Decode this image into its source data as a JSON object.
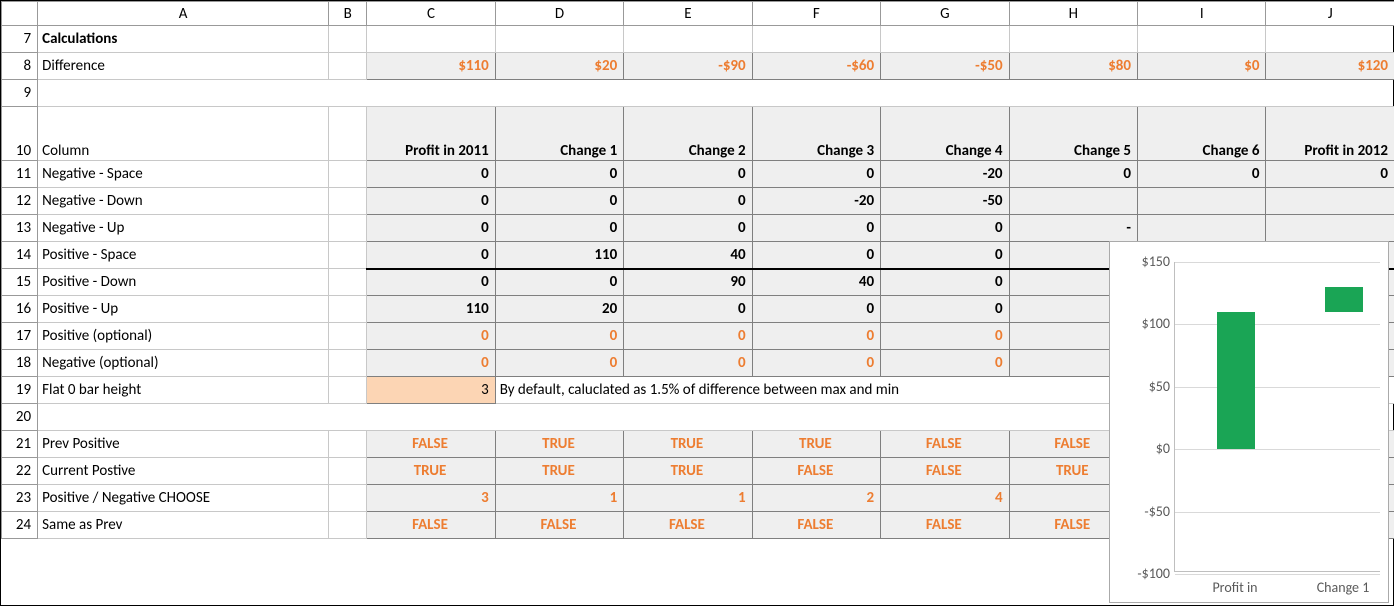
{
  "columns": [
    "A",
    "B",
    "C",
    "D",
    "E",
    "F",
    "G",
    "H",
    "I",
    "J"
  ],
  "rowNums": [
    7,
    8,
    9,
    10,
    11,
    12,
    13,
    14,
    15,
    16,
    17,
    18,
    19,
    20,
    21,
    22,
    23,
    24
  ],
  "labels": {
    "r7": "Calculations",
    "r8": "Difference",
    "r10": "Column",
    "r11": "Negative - Space",
    "r12": "Negative - Down",
    "r13": "Negative - Up",
    "r14": "Positive - Space",
    "r15": "Positive - Down",
    "r16": "Positive - Up",
    "r17": "Positive (optional)",
    "r18": "Negative (optional)",
    "r19": "Flat 0 bar height",
    "r21": "Prev Positive",
    "r22": "Current Postive",
    "r23": "Positive / Negative CHOOSE",
    "r24": "Same as Prev"
  },
  "diff": [
    "$110",
    "$20",
    "-$90",
    "-$60",
    "-$50",
    "$80",
    "$0",
    "$120"
  ],
  "colHdrs": [
    "Profit in 2011",
    "Change 1",
    "Change 2",
    "Change 3",
    "Change 4",
    "Change 5",
    "Change 6",
    "Profit in 2012"
  ],
  "r11": [
    "0",
    "0",
    "0",
    "0",
    "-20",
    "0",
    "0",
    "0"
  ],
  "r12": [
    "0",
    "0",
    "0",
    "-20",
    "-50",
    "",
    "",
    ""
  ],
  "r13": [
    "0",
    "0",
    "0",
    "0",
    "0",
    "-",
    "",
    ""
  ],
  "r14": [
    "0",
    "110",
    "40",
    "0",
    "0",
    "",
    "",
    ""
  ],
  "r15": [
    "0",
    "0",
    "90",
    "40",
    "0",
    "",
    "",
    ""
  ],
  "r16": [
    "110",
    "20",
    "0",
    "0",
    "0",
    "",
    "",
    ""
  ],
  "r17": [
    "0",
    "0",
    "0",
    "0",
    "0",
    "",
    "",
    ""
  ],
  "r18": [
    "0",
    "0",
    "0",
    "0",
    "0",
    "",
    "",
    ""
  ],
  "r19_val": "3",
  "r19_note": "By default, caluclated as 1.5% of difference between max and min",
  "r21": [
    "FALSE",
    "TRUE",
    "TRUE",
    "TRUE",
    "FALSE",
    "FALSE",
    "",
    ""
  ],
  "r22": [
    "TRUE",
    "TRUE",
    "TRUE",
    "FALSE",
    "FALSE",
    "TRUE",
    "",
    ""
  ],
  "r23": [
    "3",
    "1",
    "1",
    "2",
    "4",
    "",
    "",
    ""
  ],
  "r24": [
    "FALSE",
    "FALSE",
    "FALSE",
    "FALSE",
    "FALSE",
    "FALSE",
    "",
    ""
  ],
  "chart_data": {
    "type": "bar",
    "categories": [
      "Profit in",
      "Change 1"
    ],
    "values": [
      110,
      130
    ],
    "ylim": [
      -100,
      150
    ],
    "yticks": [
      -100,
      -50,
      0,
      50,
      100,
      150
    ],
    "ytick_labels": [
      "-$100",
      "-$50",
      "$0",
      "$50",
      "$100",
      "$150"
    ],
    "bar_color": "#1aa555",
    "bar2_style": "floating_from_110_to_130"
  }
}
